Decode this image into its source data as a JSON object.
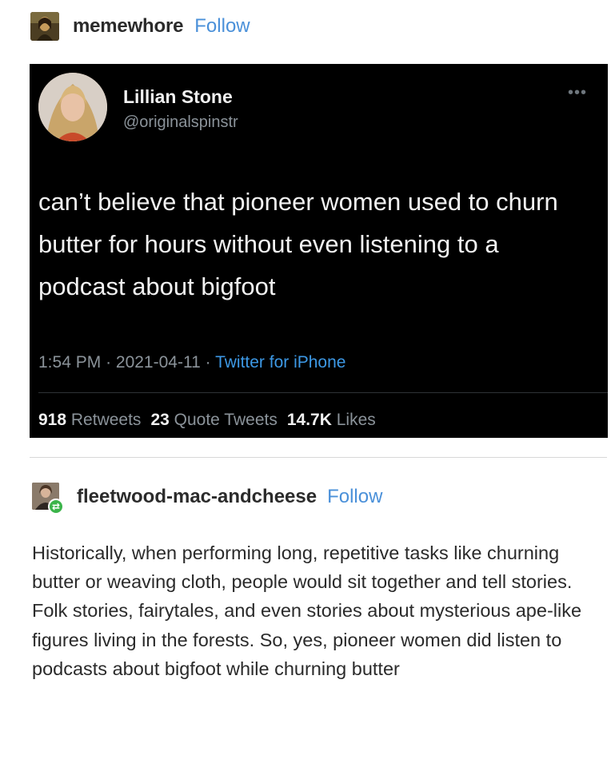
{
  "post": {
    "username": "memewhore",
    "follow_label": "Follow",
    "avatar_icon": "painting-avatar-icon"
  },
  "tweet": {
    "name": "Lillian Stone",
    "handle": "@originalspinstr",
    "more_icon": "ellipsis-icon",
    "text": "can’t believe that pioneer women used to churn butter for hours without even listening to a podcast about bigfoot",
    "time": "1:54 PM",
    "date": "2021-04-11",
    "source": "Twitter for iPhone",
    "retweets_count": "918",
    "retweets_label": "Retweets",
    "quotes_count": "23",
    "quotes_label": "Quote Tweets",
    "likes_count": "14.7K",
    "likes_label": "Likes",
    "colors": {
      "background": "#000000",
      "link": "#3d99e6",
      "muted": "#8b939a"
    }
  },
  "reblog": {
    "username": "fleetwood-mac-andcheese",
    "follow_label": "Follow",
    "badge_icon": "reblog-icon",
    "text": "Historically, when performing long, repetitive tasks like churning butter or weaving cloth, people would sit together and tell stories. Folk stories, fairytales, and even stories about mysterious ape-like figures living in the forests. So, yes, pioneer women did listen to podcasts about bigfoot while churning butter"
  },
  "colors": {
    "follow": "#4a90d9",
    "reblog_badge": "#3bb44a"
  }
}
